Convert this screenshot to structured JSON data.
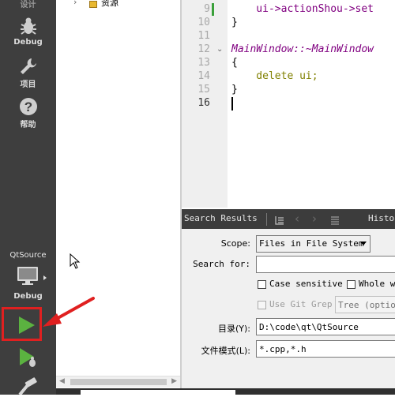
{
  "modebar": {
    "design_label": "设计",
    "debug_label": "Debug",
    "projects_label": "项目",
    "help_label": "帮助",
    "kit_project_name": "QtSource",
    "kit_build_config": "Debug"
  },
  "tree": {
    "item_label": "资源"
  },
  "editor": {
    "lines": [
      {
        "num": "9",
        "text": "    ui->actionShou->set"
      },
      {
        "num": "10",
        "text": "}"
      },
      {
        "num": "11",
        "text": ""
      },
      {
        "num": "12",
        "text": "MainWindow::~MainWindow"
      },
      {
        "num": "13",
        "text": "{"
      },
      {
        "num": "14",
        "text": "    delete ui;"
      },
      {
        "num": "15",
        "text": "}"
      },
      {
        "num": "16",
        "text": ""
      }
    ]
  },
  "search": {
    "title": "Search Results",
    "history_label": "Histo",
    "scope_label": "Scope:",
    "scope_value": "Files in File System",
    "search_for_label": "Search for:",
    "search_for_value": "",
    "case_sensitive_label": "Case sensitive",
    "whole_words_label": "Whole wo",
    "use_git_grep_label": "Use Git Grep",
    "tree_option_placeholder": "Tree (option",
    "directory_label": "目录(Y):",
    "directory_value": "D:\\code\\qt\\QtSource",
    "file_pattern_label": "文件模式(L):",
    "file_pattern_value": "*.cpp,*.h"
  },
  "colors": {
    "modebar_bg": "#3e3e3e",
    "run_green": "#5bb240",
    "annotation_red": "#e02020",
    "keyword": "#808000",
    "class": "#800080"
  }
}
